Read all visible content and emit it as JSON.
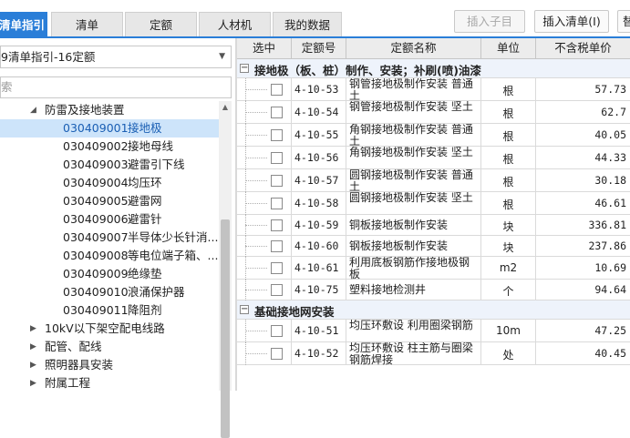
{
  "tabs": [
    {
      "label": "清单指引",
      "active": true
    },
    {
      "label": "清单",
      "active": false
    },
    {
      "label": "定额",
      "active": false
    },
    {
      "label": "人材机",
      "active": false
    },
    {
      "label": "我的数据",
      "active": false
    }
  ],
  "toolbar": {
    "insert_child": "插入子目",
    "insert_list": "插入清单(I)",
    "third_partial": "替"
  },
  "library_select": {
    "value": "9清单指引-16定额"
  },
  "search": {
    "placeholder": "索"
  },
  "tree": [
    {
      "level": 1,
      "expanded": true,
      "code": "",
      "name": "防雷及接地装置",
      "selected": false
    },
    {
      "level": 2,
      "code": "030409001",
      "name": "接地极",
      "selected": true
    },
    {
      "level": 2,
      "code": "030409002",
      "name": "接地母线",
      "selected": false
    },
    {
      "level": 2,
      "code": "030409003",
      "name": "避雷引下线",
      "selected": false
    },
    {
      "level": 2,
      "code": "030409004",
      "name": "均压环",
      "selected": false
    },
    {
      "level": 2,
      "code": "030409005",
      "name": "避雷网",
      "selected": false
    },
    {
      "level": 2,
      "code": "030409006",
      "name": "避雷针",
      "selected": false
    },
    {
      "level": 2,
      "code": "030409007",
      "name": "半导体少长针消...",
      "selected": false
    },
    {
      "level": 2,
      "code": "030409008",
      "name": "等电位端子箱、...",
      "selected": false
    },
    {
      "level": 2,
      "code": "030409009",
      "name": "绝缘垫",
      "selected": false
    },
    {
      "level": 2,
      "code": "030409010",
      "name": "浪涌保护器",
      "selected": false
    },
    {
      "level": 2,
      "code": "030409011",
      "name": "降阻剂",
      "selected": false
    },
    {
      "level": 0,
      "expanded": false,
      "code": "",
      "name": "10kV以下架空配电线路",
      "selected": false
    },
    {
      "level": 0,
      "expanded": false,
      "code": "",
      "name": "配管、配线",
      "selected": false
    },
    {
      "level": 0,
      "expanded": false,
      "code": "",
      "name": "照明器具安装",
      "selected": false
    },
    {
      "level": 0,
      "expanded": false,
      "code": "",
      "name": "附属工程",
      "selected": false
    }
  ],
  "grid": {
    "headers": [
      "选中",
      "定额号",
      "定额名称",
      "单位",
      "不含税单价"
    ],
    "groups": [
      {
        "title": "接地极（板、桩）制作、安装；补刷(喷)油漆",
        "rows": [
          {
            "code": "4-10-53",
            "name": "钢管接地极制作安装 普通土",
            "unit": "根",
            "price": "57.73"
          },
          {
            "code": "4-10-54",
            "name": "钢管接地极制作安装 坚土",
            "unit": "根",
            "price": "62.7"
          },
          {
            "code": "4-10-55",
            "name": "角钢接地极制作安装 普通土",
            "unit": "根",
            "price": "40.05"
          },
          {
            "code": "4-10-56",
            "name": "角钢接地极制作安装 坚土",
            "unit": "根",
            "price": "44.33"
          },
          {
            "code": "4-10-57",
            "name": "圆钢接地极制作安装 普通土",
            "unit": "根",
            "price": "30.18"
          },
          {
            "code": "4-10-58",
            "name": "圆钢接地极制作安装 坚土",
            "unit": "根",
            "price": "46.61"
          },
          {
            "code": "4-10-59",
            "name": "铜板接地板制作安装",
            "unit": "块",
            "price": "336.81"
          },
          {
            "code": "4-10-60",
            "name": "钢板接地板制作安装",
            "unit": "块",
            "price": "237.86"
          },
          {
            "code": "4-10-61",
            "name": "利用底板钢筋作接地极钢板",
            "unit": "m2",
            "price": "10.69"
          },
          {
            "code": "4-10-75",
            "name": "塑料接地检测井",
            "unit": "个",
            "price": "94.64"
          }
        ]
      },
      {
        "title": "基础接地网安装",
        "rows": [
          {
            "code": "4-10-51",
            "name": "均压环敷设 利用圈梁钢筋",
            "unit": "10m",
            "price": "47.25"
          },
          {
            "code": "4-10-52",
            "name": "均压环敷设 柱主筋与圈梁钢筋焊接",
            "unit": "处",
            "price": "40.45"
          }
        ]
      }
    ]
  },
  "colors": {
    "accent": "#2a7ed8",
    "selection": "#cde4fa"
  }
}
